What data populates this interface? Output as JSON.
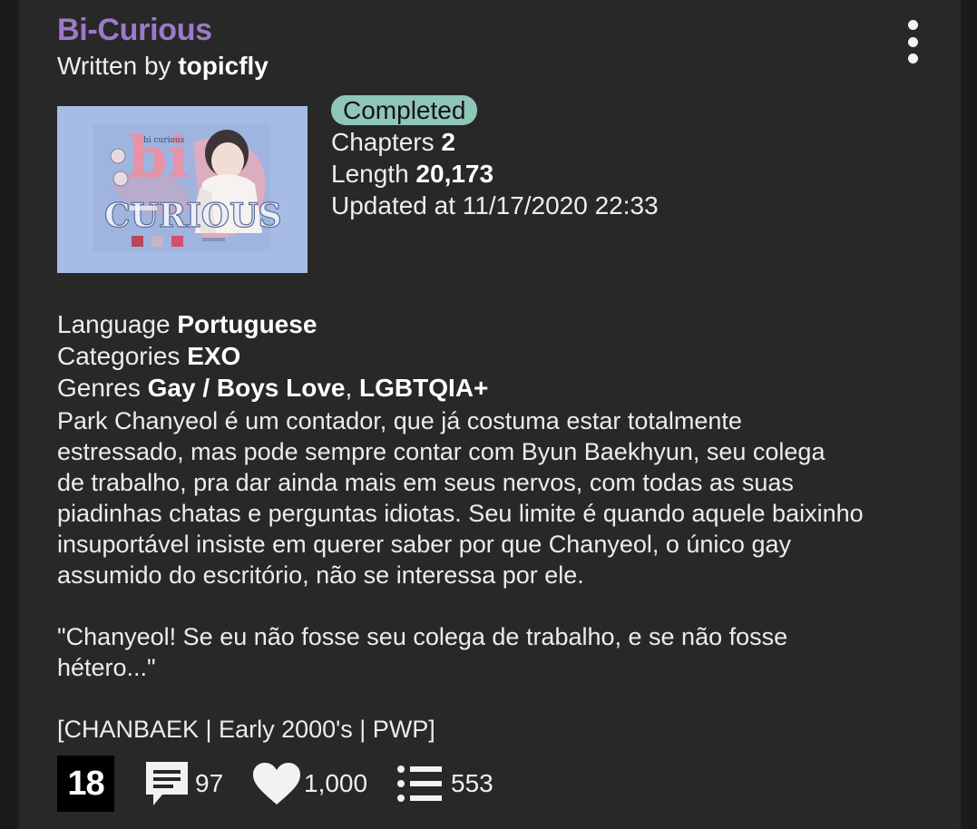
{
  "story": {
    "title": "Bi-Curious",
    "written_by_label": "Written by",
    "author": "topicfly"
  },
  "cover": {
    "art_text_top": "bi curious",
    "art_text_bi": "bi",
    "art_text_curious": "CURIOUS"
  },
  "meta": {
    "status": "Completed",
    "chapters_label": "Chapters",
    "chapters": "2",
    "length_label": "Length",
    "length": "20,173",
    "updated": "Updated at 11/17/2020 22:33"
  },
  "info": {
    "language_label": "Language",
    "language": "Portuguese",
    "categories_label": "Categories",
    "categories": "EXO",
    "genres_label": "Genres",
    "genre_1": "Gay / Boys Love",
    "genre_sep": ", ",
    "genre_2": "LGBTQIA+"
  },
  "description": {
    "lines": [
      "Park Chanyeol é um contador, que já costuma estar totalmente",
      "estressado, mas pode sempre contar com Byun Baekhyun, seu colega",
      "de trabalho, pra dar ainda mais em seus nervos, com todas as suas",
      "piadinhas chatas e perguntas idiotas. Seu limite é quando aquele baixinho",
      "insuportável insiste em querer saber por que Chanyeol, o único gay",
      "assumido do escritório, não se interessa por ele."
    ],
    "quote_lines": [
      "\"Chanyeol! Se eu não fosse seu colega de trabalho, e se não fosse",
      "hétero...\""
    ],
    "tags": "[CHANBAEK | Early 2000's | PWP]"
  },
  "stats": {
    "age_rating": "18",
    "comments": "97",
    "likes": "1,000",
    "subscribers": "553"
  },
  "icons": {
    "menu": "more-vertical-icon",
    "comments": "comment-icon",
    "likes": "heart-icon",
    "subscribers": "list-icon"
  },
  "colors": {
    "title": "#9e79c9",
    "badge": "#8fc6b8",
    "card": "#282828"
  }
}
